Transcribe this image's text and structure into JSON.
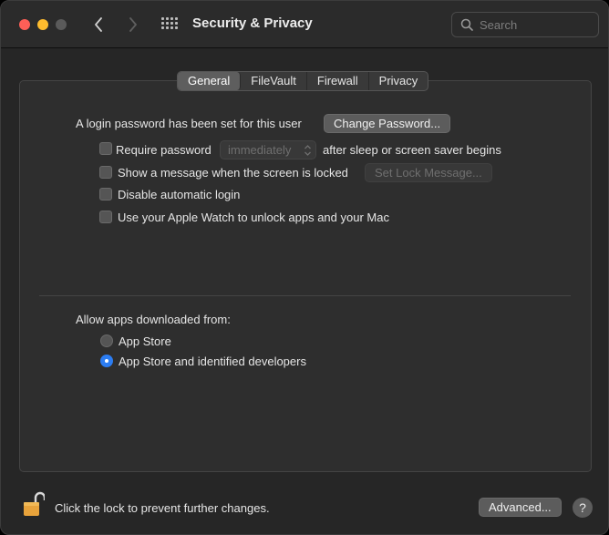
{
  "window": {
    "title": "Security & Privacy"
  },
  "search": {
    "placeholder": "Search"
  },
  "tabs": [
    {
      "label": "General",
      "active": true
    },
    {
      "label": "FileVault",
      "active": false
    },
    {
      "label": "Firewall",
      "active": false
    },
    {
      "label": "Privacy",
      "active": false
    }
  ],
  "general": {
    "login_password_text": "A login password has been set for this user",
    "change_password_label": "Change Password...",
    "require_password_label": "Require password",
    "require_password_delay": "immediately",
    "after_sleep_text": "after sleep or screen saver begins",
    "show_message_label": "Show a message when the screen is locked",
    "set_lock_message_label": "Set Lock Message...",
    "disable_auto_login_label": "Disable automatic login",
    "apple_watch_label": "Use your Apple Watch to unlock apps and your Mac",
    "allow_apps_heading": "Allow apps downloaded from:",
    "option_app_store": "App Store",
    "option_app_store_identified": "App Store and identified developers",
    "selected_option": "App Store and identified developers"
  },
  "footer": {
    "lock_text": "Click the lock to prevent further changes.",
    "advanced_label": "Advanced...",
    "help_label": "?"
  },
  "colors": {
    "accent": "#2c7df2",
    "lock": "#e8a33b"
  }
}
